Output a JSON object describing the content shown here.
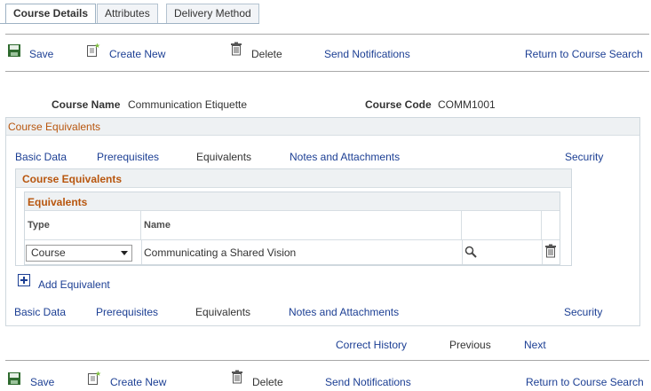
{
  "tabs": [
    {
      "label": "Course Details",
      "active": true
    },
    {
      "label": "Attributes",
      "active": false
    },
    {
      "label": "Delivery Method",
      "active": false
    }
  ],
  "toolbar": {
    "save": "Save",
    "create_new": "Create New",
    "delete": "Delete",
    "send_notifications": "Send Notifications",
    "return_search": "Return to Course Search"
  },
  "course": {
    "name_label": "Course Name",
    "name_value": "Communication Etiquette",
    "code_label": "Course Code",
    "code_value": "COMM1001"
  },
  "section_title": "Course Equivalents",
  "subnav": {
    "basic_data": "Basic Data",
    "prerequisites": "Prerequisites",
    "equivalents": "Equivalents",
    "notes": "Notes and Attachments",
    "security": "Security"
  },
  "panel": {
    "title": "Course Equivalents",
    "grid_title": "Equivalents",
    "col_type": "Type",
    "col_name": "Name",
    "row": {
      "type": "Course",
      "name": "Communicating a Shared Vision"
    }
  },
  "add_equivalent": "Add Equivalent",
  "history": {
    "correct": "Correct History",
    "previous": "Previous",
    "next": "Next"
  },
  "colors": {
    "link": "#1c3f94",
    "section_title": "#b8560e",
    "header_bg": "#eef1f3"
  }
}
